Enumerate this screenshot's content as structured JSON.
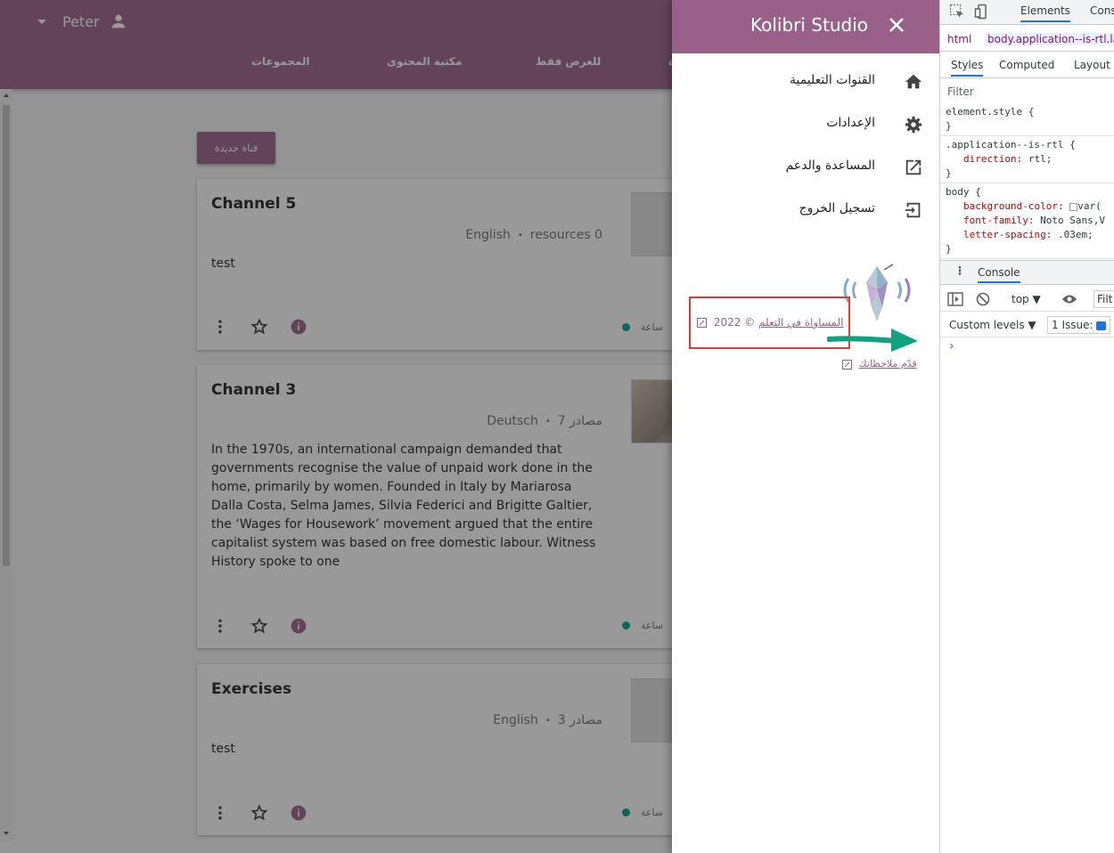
{
  "app": {
    "user_name": "Peter",
    "nav_tabs": [
      "المجموعات",
      "مكتبة المحتوى",
      "للعرض فقط",
      "ة"
    ],
    "new_channel_label": "قناة جديدة"
  },
  "channels": [
    {
      "title": "Channel 5",
      "language": "English",
      "resources": "resources 0",
      "description": "test",
      "status": "ساعة"
    },
    {
      "title": "Channel 3",
      "language": "Deutsch",
      "resources": "7 مصادر",
      "description": "In the 1970s, an international campaign demanded that governments recognise the value of unpaid work done in the home, primarily by women. Founded in Italy by Mariarosa Dalla Costa, Selma James, Silvia Federici and Brigitte Galtier, the ‘Wages for Housework’ movement argued that the entire capitalist system was based on free domestic labour. Witness History spoke to one",
      "status": "ساعة"
    },
    {
      "title": "Exercises",
      "language": "English",
      "resources": "3 مصادر",
      "description": "test",
      "status": "ساعة"
    }
  ],
  "drawer": {
    "title": "Kolibri Studio",
    "menu": [
      {
        "label": "القنوات التعليمية",
        "icon": "home-icon"
      },
      {
        "label": "الإعدادات",
        "icon": "gear-icon"
      },
      {
        "label": "المساعدة والدعم",
        "icon": "open-in-new-icon"
      },
      {
        "label": "تسجيل الخروج",
        "icon": "logout-icon"
      }
    ],
    "copyright_symbol": "© 2022",
    "copyright_link": "المساواة في التعلم",
    "feedback_link": "قدّم ملاحظاتك"
  },
  "devtools": {
    "top_tabs": [
      "Elements",
      "Cons"
    ],
    "breadcrumbs": [
      "html",
      "body.application--is-rtl.la"
    ],
    "sub_tabs": [
      "Styles",
      "Computed",
      "Layout"
    ],
    "filter_placeholder": "Filter",
    "css_rules": [
      {
        "selector": "element.style {",
        "props": [],
        "close": "}"
      },
      {
        "selector": ".application--is-rtl {",
        "props": [
          {
            "name": "direction",
            "value": "rtl;"
          }
        ],
        "close": "}"
      },
      {
        "selector": "body {",
        "props": [
          {
            "name": "background-color",
            "value": "var("
          },
          {
            "name": "font-family",
            "value": "Noto Sans,V"
          },
          {
            "name": "letter-spacing",
            "value": ".03em;"
          }
        ],
        "close": "}"
      }
    ],
    "console_tab": "Console",
    "context": "top",
    "filter_short": "Filt",
    "levels": "Custom levels",
    "issues": "1 Issue:",
    "prompt": "›"
  },
  "colors": {
    "brand": "#996189",
    "accent": "#00a08a",
    "highlight": "#e53935"
  }
}
